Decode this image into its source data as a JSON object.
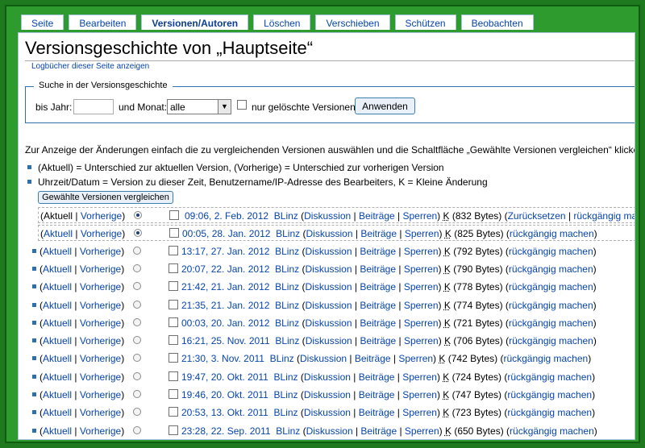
{
  "tabs": [
    "Seite",
    "Bearbeiten",
    "Versionen/Autoren",
    "Löschen",
    "Verschieben",
    "Schützen",
    "Beobachten"
  ],
  "page_title": "Versionsgeschichte von „Hauptseite“",
  "log_link": "Logbücher dieser Seite anzeigen",
  "search": {
    "legend": "Suche in der Versionsgeschichte",
    "year_label": "bis Jahr:",
    "year_value": "",
    "month_label": "und Monat:",
    "month_value": "alle",
    "deleted_label": "nur gelöschte Versionen",
    "apply_label": "Anwenden"
  },
  "instructions": "Zur Anzeige der Änderungen einfach die zu vergleichenden Versionen auswählen und die Schaltfläche „Gewählte Versionen vergleichen“ klicken.",
  "legend_lines": [
    "(Aktuell) = Unterschied zur aktuellen Version, (Vorherige) = Unterschied zur vorherigen Version",
    "Uhrzeit/Datum = Version zu dieser Zeit, Benutzername/IP-Adresse des Bearbeiters, K = Kleine Änderung"
  ],
  "compare_label": "Gewählte Versionen vergleichen",
  "labels": {
    "current": "Aktuell",
    "previous": "Vorherige",
    "discussion": "Diskussion",
    "contributions": "Beiträge",
    "block": "Sperren",
    "minor": "K",
    "rollback": "Zurücksetzen",
    "undo": "rückgängig machen"
  },
  "revisions": [
    {
      "date": "09:06, 2. Feb. 2012",
      "user": "BLinz",
      "size": "(832 Bytes)",
      "first": true
    },
    {
      "date": "00:05, 28. Jan. 2012",
      "user": "BLinz",
      "size": "(825 Bytes)"
    },
    {
      "date": "13:17, 27. Jan. 2012",
      "user": "BLinz",
      "size": "(792 Bytes)"
    },
    {
      "date": "20:07, 22. Jan. 2012",
      "user": "BLinz",
      "size": "(790 Bytes)"
    },
    {
      "date": "21:42, 21. Jan. 2012",
      "user": "BLinz",
      "size": "(778 Bytes)"
    },
    {
      "date": "21:35, 21. Jan. 2012",
      "user": "BLinz",
      "size": "(774 Bytes)"
    },
    {
      "date": "00:03, 20. Jan. 2012",
      "user": "BLinz",
      "size": "(721 Bytes)"
    },
    {
      "date": "16:21, 25. Nov. 2011",
      "user": "BLinz",
      "size": "(706 Bytes)"
    },
    {
      "date": "21:30, 3. Nov. 2011",
      "user": "BLinz",
      "size": "(742 Bytes)"
    },
    {
      "date": "19:47, 20. Okt. 2011",
      "user": "BLinz",
      "size": "(724 Bytes)"
    },
    {
      "date": "19:46, 20. Okt. 2011",
      "user": "BLinz",
      "size": "(747 Bytes)"
    },
    {
      "date": "20:53, 13. Okt. 2011",
      "user": "BLinz",
      "size": "(723 Bytes)"
    },
    {
      "date": "23:28, 22. Sep. 2011",
      "user": "BLinz",
      "size": "(650 Bytes)"
    }
  ]
}
